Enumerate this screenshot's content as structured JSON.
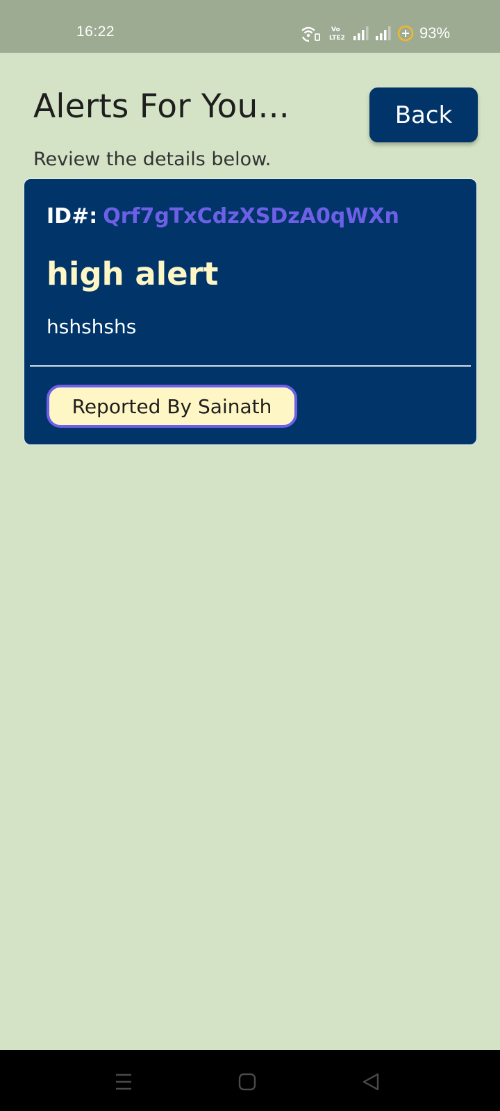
{
  "status_bar": {
    "time": "16:22",
    "battery": "93%",
    "icons": [
      "wifi-calling-icon",
      "volte-icon",
      "signal-icon",
      "signal-icon",
      "battery-saver-icon"
    ]
  },
  "header": {
    "title": "Alerts For You...",
    "back_label": "Back",
    "subtitle": "Review the details below."
  },
  "alert": {
    "id_label": "ID#:",
    "id_value": "Qrf7gTxCdzXSDzA0qWXn",
    "title": "high alert",
    "description": "hshshshs",
    "reporter": "Reported By Sainath"
  },
  "navigation": {
    "buttons": [
      "menu-icon",
      "home-icon",
      "back-icon"
    ]
  },
  "colors": {
    "background": "#d4e3c5",
    "status_bar": "#9eab93",
    "primary": "#01356a",
    "accent": "#6d60e6",
    "highlight": "#fff6c5"
  }
}
